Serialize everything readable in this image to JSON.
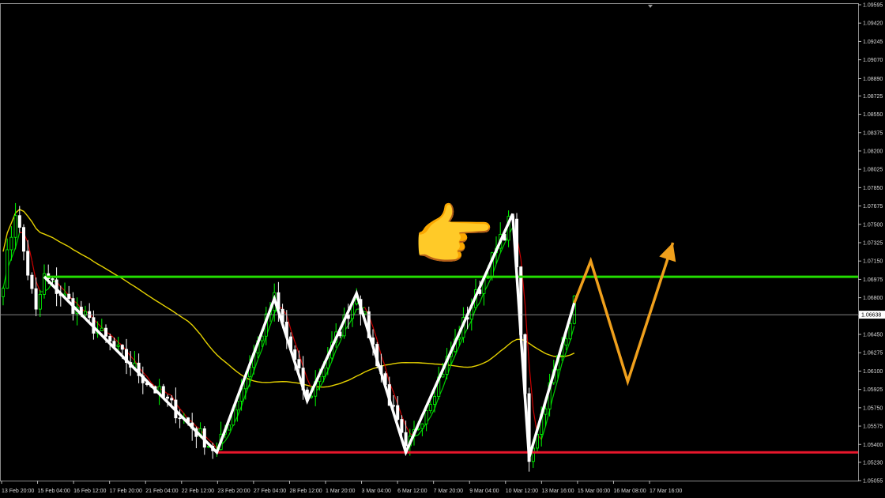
{
  "chart_data": {
    "type": "candlestick",
    "background": "#000000",
    "y_axis": {
      "ticks": [
        "1.09595",
        "1.09420",
        "1.09245",
        "1.09070",
        "1.08890",
        "1.08725",
        "1.08550",
        "1.08375",
        "1.08200",
        "1.08025",
        "1.07850",
        "1.07675",
        "1.07500",
        "1.07325",
        "1.07150",
        "1.06975",
        "1.06800",
        "1.06625",
        "1.06450",
        "1.06275",
        "1.06100",
        "1.05925",
        "1.05750",
        "1.05575",
        "1.05400",
        "1.05230",
        "1.05055"
      ],
      "ylim": [
        1.05055,
        1.09595
      ]
    },
    "x_axis": {
      "ticks": [
        "13 Feb 20:00",
        "15 Feb 04:00",
        "16 Feb 12:00",
        "17 Feb 20:00",
        "21 Feb 04:00",
        "22 Feb 12:00",
        "23 Feb 20:00",
        "27 Feb 04:00",
        "28 Feb 12:00",
        "1 Mar 20:00",
        "3 Mar 04:00",
        "6 Mar 12:00",
        "7 Mar 20:00",
        "9 Mar 04:00",
        "10 Mar 12:00",
        "13 Mar 16:00",
        "15 Mar 00:00",
        "16 Mar 08:00",
        "17 Mar 16:00"
      ]
    },
    "current_price": "1.06638",
    "colors": {
      "bull_candle": "#00ff00",
      "bear_candle": "#ffffff",
      "moving_average_slow": "#e6d200",
      "moving_average_fast_up": "#00cc00",
      "moving_average_fast_down": "#cc0000",
      "zigzag": "#ffffff",
      "resistance": "#22dd00",
      "support": "#e8172c",
      "projection": "#f0a01c",
      "price_line": "#b0b0b0"
    },
    "levels": {
      "resistance": 1.07,
      "support": 1.05325
    },
    "zigzag": [
      {
        "bar": 10,
        "price": 1.07
      },
      {
        "bar": 52,
        "price": 1.05325
      },
      {
        "bar": 66,
        "price": 1.0679
      },
      {
        "bar": 74,
        "price": 1.05815
      },
      {
        "bar": 86,
        "price": 1.0684
      },
      {
        "bar": 98,
        "price": 1.05325
      },
      {
        "bar": 124,
        "price": 1.076
      },
      {
        "bar": 128,
        "price": 1.05275
      },
      {
        "bar": 139,
        "price": 1.0675
      }
    ],
    "projection": [
      {
        "bar": 139,
        "price": 1.0675
      },
      {
        "bar": 143,
        "price": 1.0715
      },
      {
        "bar": 152,
        "price": 1.06
      },
      {
        "bar": 163,
        "price": 1.07325
      }
    ],
    "pointer_emoji": "👉"
  }
}
